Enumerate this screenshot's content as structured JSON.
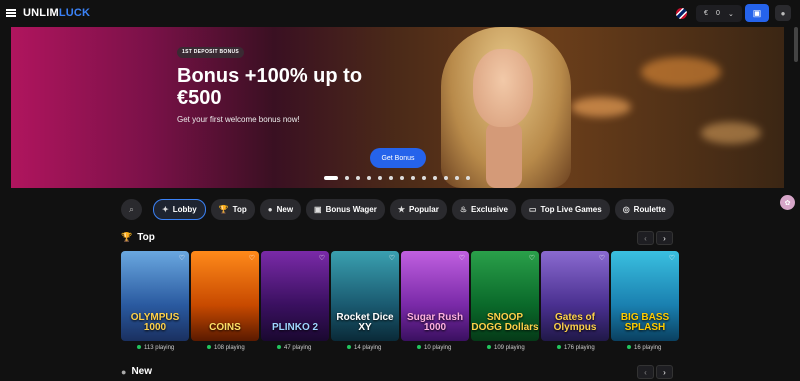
{
  "header": {
    "logo_primary": "UNLIM",
    "logo_accent": "LUCK",
    "currency": "€",
    "balance": "0"
  },
  "banner": {
    "badge": "1ST DEPOSIT BONUS",
    "title": "Bonus +100% up to €500",
    "subtitle": "Get your first welcome bonus now!",
    "cta": "Get Bonus",
    "slides": 13,
    "active_slide": 1
  },
  "categories": [
    {
      "label": "Lobby",
      "icon": "lobby-icon",
      "glyph": "✦",
      "active": true
    },
    {
      "label": "Top",
      "icon": "trophy-icon",
      "glyph": "🏆",
      "active": false
    },
    {
      "label": "New",
      "icon": "new-icon",
      "glyph": "●",
      "active": false
    },
    {
      "label": "Bonus Wager",
      "icon": "gift-icon",
      "glyph": "▣",
      "active": false
    },
    {
      "label": "Popular",
      "icon": "star-icon",
      "glyph": "★",
      "active": false
    },
    {
      "label": "Exclusive",
      "icon": "flame-icon",
      "glyph": "♨",
      "active": false
    },
    {
      "label": "Top Live Games",
      "icon": "live-icon",
      "glyph": "▭",
      "active": false
    },
    {
      "label": "Roulette",
      "icon": "roulette-icon",
      "glyph": "◎",
      "active": false
    }
  ],
  "sections": {
    "top": "Top",
    "new": "New"
  },
  "games": [
    {
      "name": "OLYMPUS 1000",
      "playing": "113 playing",
      "bg": "linear-gradient(180deg,#6aa8e0,#2a5aa0 60%,#1a3060)",
      "color": "#ffd24a"
    },
    {
      "name": "COINS",
      "playing": "108 playing",
      "bg": "linear-gradient(180deg,#ff8a1a,#c84a00 60%,#5a1a00)",
      "color": "#ffe066"
    },
    {
      "name": "PLINKO 2",
      "playing": "47 playing",
      "bg": "linear-gradient(180deg,#7a2aa8,#3a1060 60%,#1a0830)",
      "color": "#9fd4ff"
    },
    {
      "name": "Rocket Dice XY",
      "playing": "14 playing",
      "bg": "linear-gradient(180deg,#3aa0b0,#1a5a70 60%,#0a2a38)",
      "color": "#ffffff"
    },
    {
      "name": "Sugar Rush 1000",
      "playing": "10 playing",
      "bg": "linear-gradient(180deg,#c060e0,#7a2aa8 60%,#3a1060)",
      "color": "#ffb0e0"
    },
    {
      "name": "SNOOP DOGG Dollars",
      "playing": "109 playing",
      "bg": "linear-gradient(180deg,#2aa04a,#0a6a2a 60%,#053a18)",
      "color": "#ffd24a"
    },
    {
      "name": "Gates of Olympus",
      "playing": "176 playing",
      "bg": "linear-gradient(180deg,#8a6ad0,#4a3090 60%,#201848)",
      "color": "#ffd24a"
    },
    {
      "name": "BIG BASS SPLASH",
      "playing": "16 playing",
      "bg": "linear-gradient(180deg,#3ac0e0,#1a80b0 60%,#0a4060)",
      "color": "#ffcc00"
    }
  ]
}
